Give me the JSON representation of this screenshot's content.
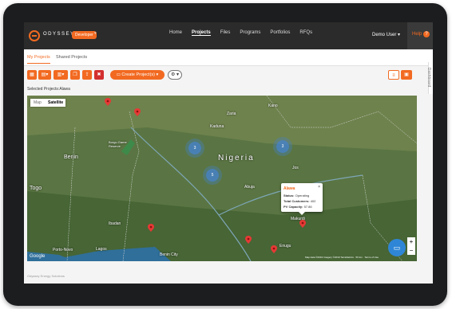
{
  "app": {
    "brand": "ODYSSEY",
    "badge": "Developer"
  },
  "nav": [
    "Home",
    "Projects",
    "Files",
    "Programs",
    "Portfolios",
    "RFQs"
  ],
  "nav_active": "Projects",
  "user": "Demo User",
  "help": "Help",
  "help_icon": "?",
  "tabs": {
    "my_projects": "My Projects",
    "shared_projects": "Shared Projects"
  },
  "toolbar": {
    "create_label": "Create Project(s)",
    "settings_label": "⚙ ▾"
  },
  "selected_projects": {
    "label": "Selected Projects:",
    "value": "Alawa"
  },
  "side_panel": {
    "label": "Dashboard"
  },
  "map": {
    "toggle": {
      "map": "Map",
      "satellite": "Satellite"
    },
    "labels": {
      "country": "Nigeria",
      "benin": "Benin",
      "togo": "Togo",
      "porto_novo": "Porto-Novo",
      "kaduna": "Kaduna",
      "zaria": "Zaria",
      "kano": "Kano",
      "ibadan": "Ibadan",
      "lagos": "Lagos",
      "abuja": "Abuja",
      "jos": "Jos",
      "makurdi": "Makurdi",
      "enugu": "Enugu",
      "benin_city": "Benin City",
      "borgu": "Borgu Game Reserve"
    },
    "popup": {
      "name": "Alawa",
      "status_label": "Status:",
      "status_value": "Operating",
      "customers_label": "Total Customers:",
      "customers_value": "402",
      "pv_label": "PV Capacity:",
      "pv_value": "57.86"
    },
    "clusters": [
      "3",
      "3",
      "5"
    ],
    "zoom_in": "+",
    "zoom_out": "−",
    "google": "Google",
    "attribution": "Map data ©2019 Imagery ©2019 TerraMetrics · 50 km · Terms of Use"
  },
  "colors": {
    "accent": "#f26a21",
    "topbar": "#2b2b2b",
    "pin": "#e53935",
    "cluster": "#4682c8"
  },
  "footer": "Odyssey Energy Solutions"
}
